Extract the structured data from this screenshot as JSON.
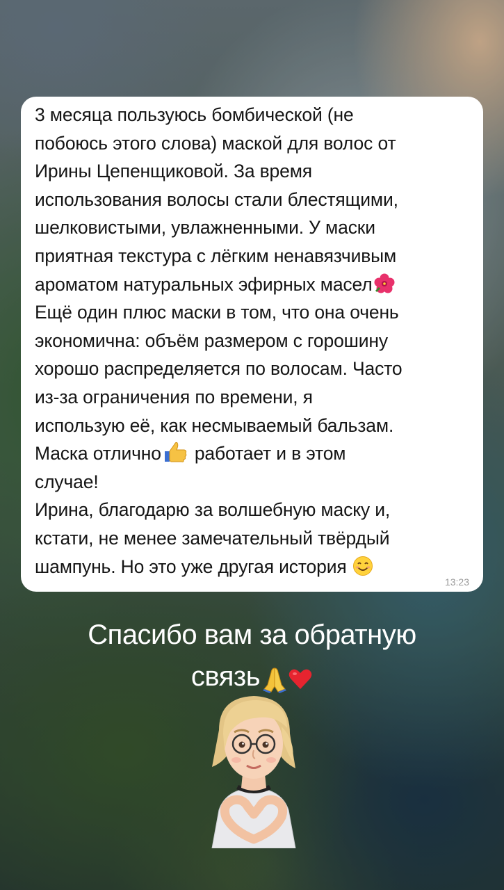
{
  "story": {
    "message": {
      "lines": [
        "3 месяца пользуюсь бомбической (не",
        "побоюсь этого слова) маской для волос от",
        "Ирины Цепенщиковой. За время",
        "использования волосы стали блестящими,",
        "шелковистыми, увлажненными. У маски",
        "приятная текстура с лёгким ненавязчивым",
        "ароматом натуральных эфирных масел",
        "Ещё один плюс маски в том, что она очень",
        "экономична: объём размером с горошину",
        "хорошо распределяется по волосам. Часто",
        "из-за ограничения по времени, я",
        "использую её, как несмываемый бальзам.",
        "Маска отлично",
        "работает и в этом",
        "случае!",
        "Ирина, благодарю за волшебную маску и,",
        "кстати, не менее замечательный твёрдый",
        "шампунь. Но это уже другая история"
      ],
      "time": "13:23",
      "icons": {
        "flower": "hibiscus-emoji",
        "thumbs_up": "thumbs-up-emoji",
        "smile": "smiling-face-emoji"
      }
    },
    "caption": {
      "line1": "Спасибо вам за обратную",
      "line2": "связь",
      "icons": [
        "folded-hands-emoji",
        "red-heart-emoji"
      ]
    },
    "avatar": "memoji-heart-hands",
    "colors": {
      "bubble": "#ffffff",
      "text": "#151515",
      "time": "#9a9a9a",
      "caption": "#ffffff"
    }
  }
}
